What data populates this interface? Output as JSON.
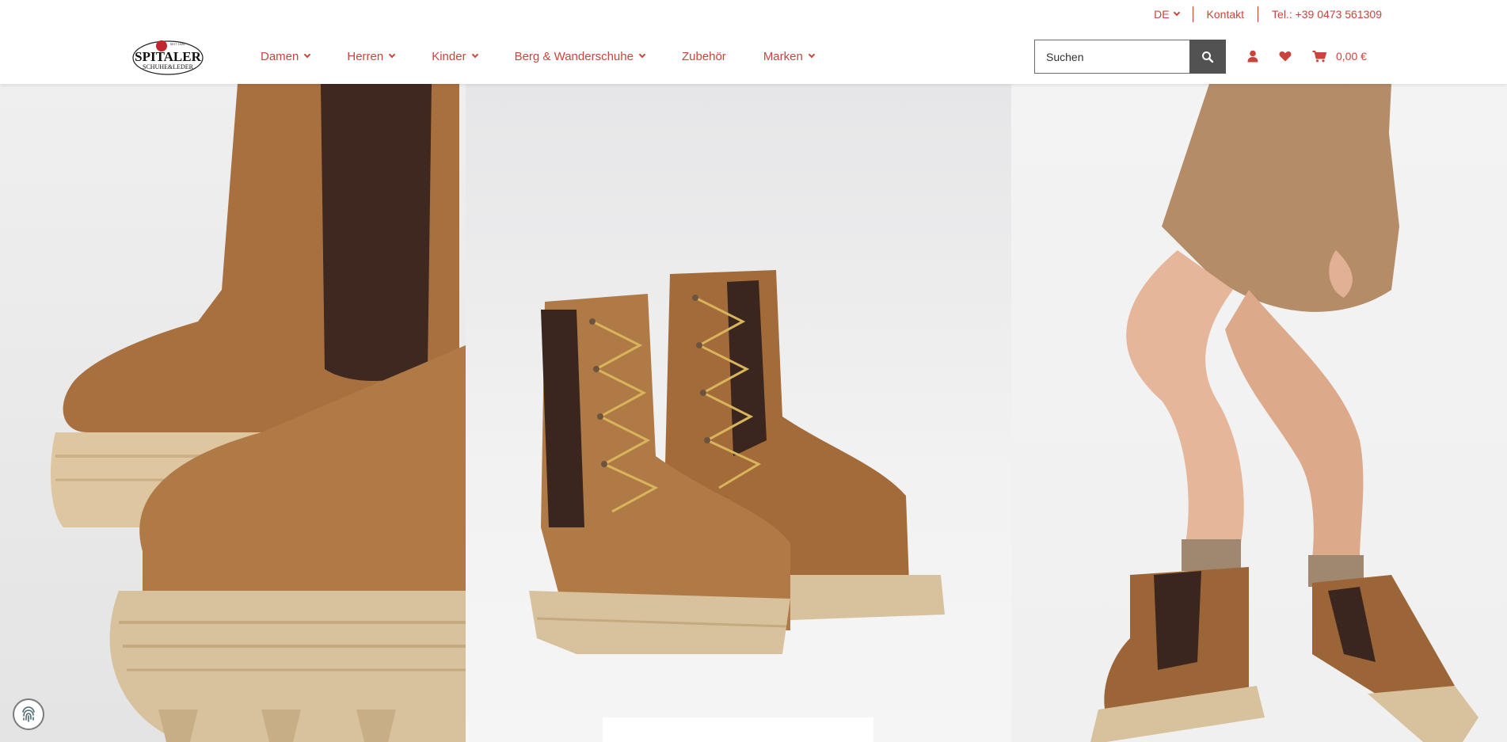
{
  "topbar": {
    "language": "DE",
    "contact": "Kontakt",
    "phone": "Tel.: +39 0473 561309"
  },
  "logo": {
    "brand": "SPITALER",
    "tagline": "SCHUHE & LEDER",
    "since": "SEIT 1926"
  },
  "nav": {
    "items": [
      {
        "label": "Damen",
        "has_dropdown": true
      },
      {
        "label": "Herren",
        "has_dropdown": true
      },
      {
        "label": "Kinder",
        "has_dropdown": true
      },
      {
        "label": "Berg & Wanderschuhe",
        "has_dropdown": true
      },
      {
        "label": "Zubehör",
        "has_dropdown": false
      },
      {
        "label": "Marken",
        "has_dropdown": true
      }
    ]
  },
  "search": {
    "placeholder": "Suchen",
    "icon": "search-icon"
  },
  "header_icons": {
    "account_icon": "user-icon",
    "wishlist_icon": "heart-icon",
    "cart_icon": "cart-icon",
    "cart_total": "0,00 €"
  },
  "cookie": {
    "icon": "fingerprint-icon"
  },
  "colors": {
    "accent": "#c7453d",
    "search_button": "#525252",
    "boot": "#a86a3a",
    "sole": "#d8c29e"
  }
}
